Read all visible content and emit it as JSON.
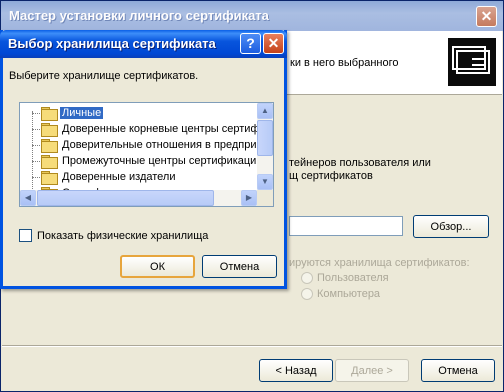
{
  "wizard": {
    "title": "Мастер установки личного сертификата",
    "close_glyph": "✕",
    "header_text": "ки в него  выбранного",
    "body_line1": "тейнеров пользователя или",
    "body_line2": "щ сертификатов",
    "browse_label": "Обзор...",
    "store_label": "ируются хранилища сертификатов:",
    "radio_user": "Пользователя",
    "radio_computer": "Компьютера",
    "back_label": "< Назад",
    "next_label": "Далее >",
    "cancel_label": "Отмена"
  },
  "dialog": {
    "title": "Выбор хранилища сертификата",
    "help_glyph": "?",
    "close_glyph": "✕",
    "prompt": "Выберите хранилище сертификатов.",
    "stores": [
      {
        "label": "Личные",
        "selected": true
      },
      {
        "label": "Доверенные корневые центры сертиф",
        "selected": false
      },
      {
        "label": "Доверительные отношения в предпри",
        "selected": false
      },
      {
        "label": "Промежуточные центры сертификаци",
        "selected": false
      },
      {
        "label": "Доверенные издатели",
        "selected": false
      },
      {
        "label": "Сертификаты, к которым нет доверия",
        "selected": false
      }
    ],
    "show_physical_label": "Показать физические хранилища",
    "show_physical_checked": false,
    "ok_label": "ОК",
    "cancel_label": "Отмена"
  },
  "icons": {
    "tree_item_icon": "folder-icon",
    "header_icon": "certificate-icon"
  }
}
